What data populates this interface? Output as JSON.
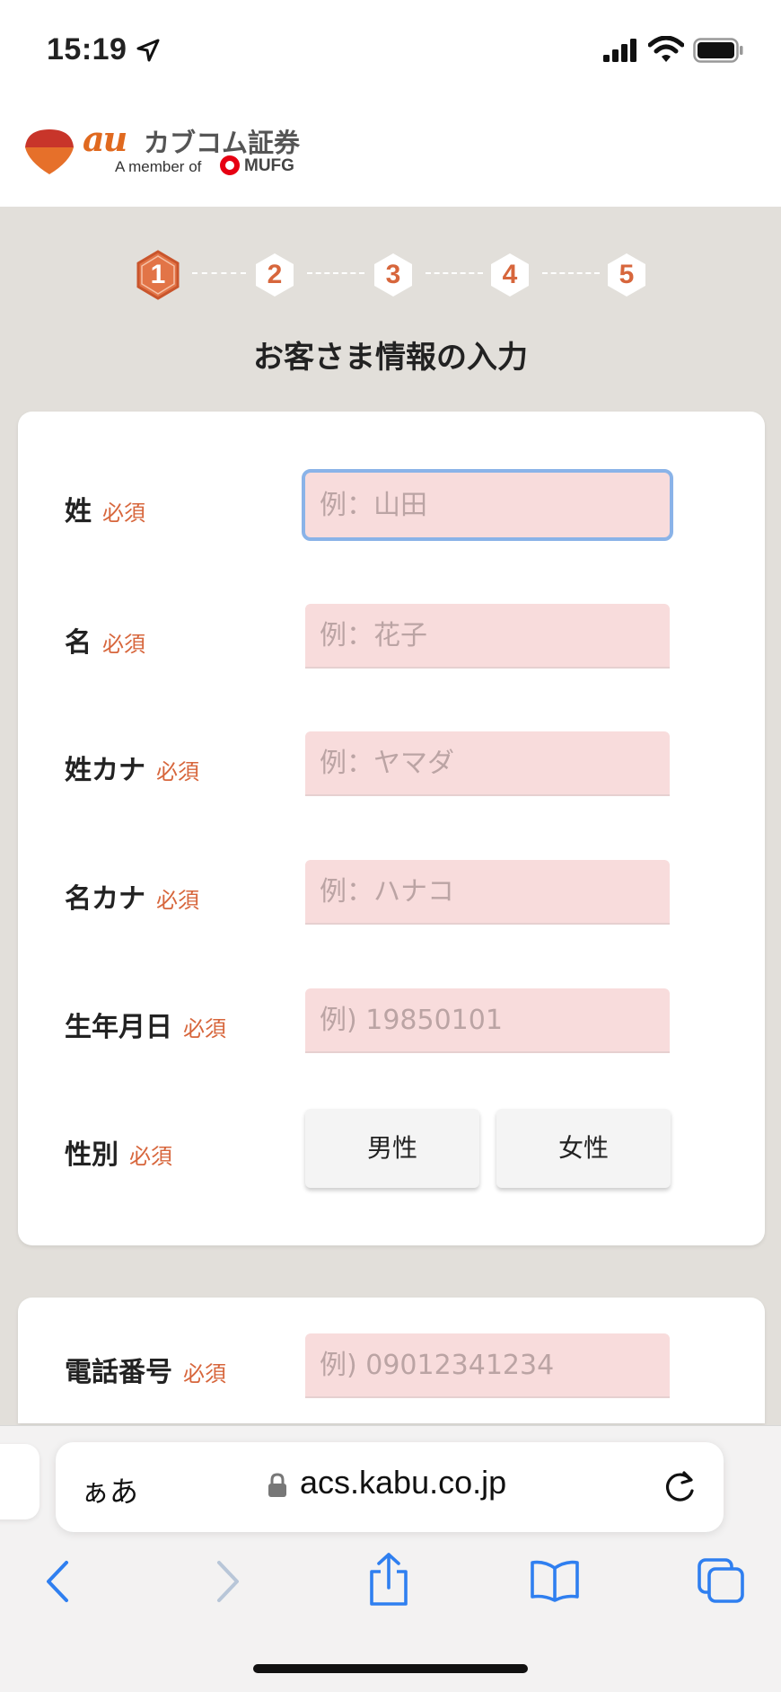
{
  "status": {
    "time": "15:19"
  },
  "brand": {
    "au": "au",
    "name": "カブコム証券",
    "member_text": "A member of",
    "mufg": "MUFG"
  },
  "steps": [
    "1",
    "2",
    "3",
    "4",
    "5"
  ],
  "page_title": "お客さま情報の入力",
  "required_label": "必須",
  "form": {
    "last_name": {
      "label": "姓",
      "placeholder": "例：山田",
      "value": ""
    },
    "first_name": {
      "label": "名",
      "placeholder": "例：花子",
      "value": ""
    },
    "last_name_kana": {
      "label": "姓カナ",
      "placeholder": "例：ヤマダ",
      "value": ""
    },
    "first_name_kana": {
      "label": "名カナ",
      "placeholder": "例：ハナコ",
      "value": ""
    },
    "birthdate": {
      "label": "生年月日",
      "placeholder": "例) 19850101",
      "value": ""
    },
    "gender": {
      "label": "性別",
      "male": "男性",
      "female": "女性"
    },
    "phone": {
      "label": "電話番号",
      "placeholder": "例) 09012341234",
      "value": ""
    }
  },
  "browser": {
    "text_size_label": "ぁあ",
    "url": "acs.kabu.co.jp"
  },
  "colors": {
    "accent": "#d7663c",
    "field_bg": "#f8dcdc",
    "page_bg": "#e2dfda",
    "focus": "#8ab3e8"
  }
}
